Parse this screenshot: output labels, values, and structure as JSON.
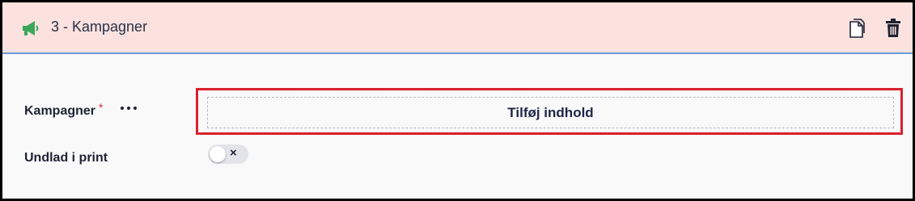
{
  "colors": {
    "header_bg": "#fbe2df",
    "accent_border": "#6b9bd6",
    "highlight": "#d7222d",
    "icon_green": "#3aa75b",
    "required": "#d0323a"
  },
  "header": {
    "icon": "megaphone-icon",
    "title": "3 - Kampagner",
    "actions": [
      "copy-icon",
      "trash-icon"
    ]
  },
  "fields": {
    "kampagner": {
      "label": "Kampagner",
      "required_mark": "*",
      "more_icon": "more-horizontal-icon",
      "add_label": "Tilføj indhold"
    },
    "exclude_print": {
      "label": "Undlad i print",
      "toggle_state": false,
      "toggle_glyph": "×"
    }
  }
}
